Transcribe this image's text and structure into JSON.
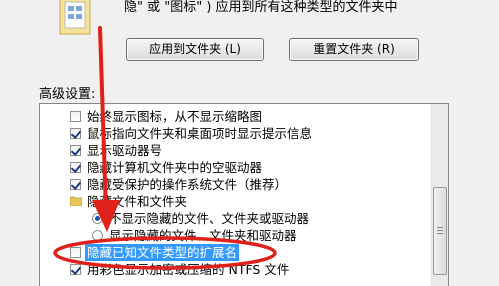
{
  "description": {
    "text": "隐\" 或 \"图标\" ) 应用到所有这种类型的文件夹中"
  },
  "buttons": {
    "apply_label": "应用到文件夹 (L)",
    "reset_label": "重置文件夹 (R)"
  },
  "advanced": {
    "label": "高级设置:"
  },
  "list": {
    "items": [
      {
        "type": "checkbox",
        "checked": false,
        "label": "始终显示图标，从不显示缩略图"
      },
      {
        "type": "checkbox",
        "checked": true,
        "label": "鼠标指向文件夹和桌面项时显示提示信息"
      },
      {
        "type": "checkbox",
        "checked": true,
        "label": "显示驱动器号"
      },
      {
        "type": "checkbox",
        "checked": true,
        "label": "隐藏计算机文件夹中的空驱动器"
      },
      {
        "type": "checkbox",
        "checked": true,
        "label": "隐藏受保护的操作系统文件（推荐）"
      },
      {
        "type": "folder",
        "label": "隐藏文件和文件夹"
      },
      {
        "type": "radio",
        "selected": true,
        "label": "不显示隐藏的文件、文件夹或驱动器"
      },
      {
        "type": "radio",
        "selected": false,
        "label": "显示隐藏的文件、文件夹和驱动器"
      },
      {
        "type": "checkbox",
        "checked": false,
        "label": "隐藏已知文件类型的扩展名",
        "highlighted": true
      },
      {
        "type": "checkbox",
        "checked": true,
        "label": "用彩色显示加密或压缩的 NTFS 文件"
      }
    ]
  },
  "colors": {
    "selection": "#3399ff",
    "annotation_red": "#e0201a"
  }
}
